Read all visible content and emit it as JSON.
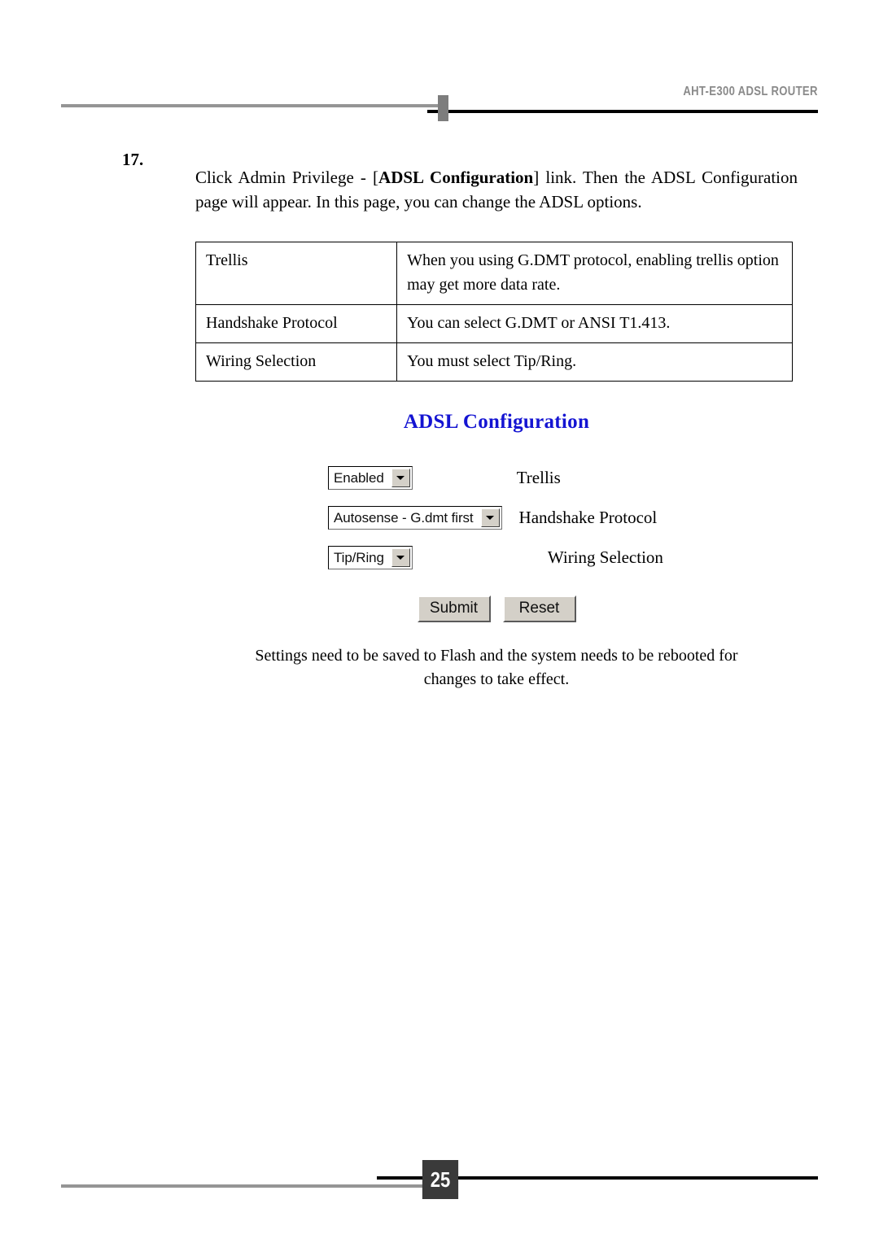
{
  "header": {
    "title": "AHT-E300 ADSL ROUTER"
  },
  "item": {
    "number": "17.",
    "text_part1": "Click Admin Privilege - [",
    "text_bold": "ADSL Configuration",
    "text_part2": "] link. Then the ADSL Configuration page will appear. In this page, you can change the ADSL options."
  },
  "table": {
    "rows": [
      {
        "key": "Trellis",
        "value": "When you using G.DMT protocol, enabling trellis option may get more data rate."
      },
      {
        "key": "Handshake Protocol",
        "value": "You can select G.DMT or ANSI T1.413."
      },
      {
        "key": "Wiring Selection",
        "value": "You must select Tip/Ring."
      }
    ]
  },
  "screenshot": {
    "title": "ADSL Configuration",
    "fields": [
      {
        "value": "Enabled",
        "label": "Trellis"
      },
      {
        "value": "Autosense - G.dmt first",
        "label": "Handshake Protocol"
      },
      {
        "value": "Tip/Ring",
        "label": "Wiring Selection"
      }
    ],
    "buttons": {
      "submit": "Submit",
      "reset": "Reset"
    },
    "note_line1": "Settings need to be saved to Flash and the system needs to be rebooted for",
    "note_line2": "changes to take effect."
  },
  "footer": {
    "page_number": "25"
  },
  "colors": {
    "heading_blue": "#1414d2",
    "header_gray": "#8a8a8a",
    "rule_gray": "#959595",
    "page_box": "#3a3a3a",
    "button_face": "#d4d0c8"
  }
}
